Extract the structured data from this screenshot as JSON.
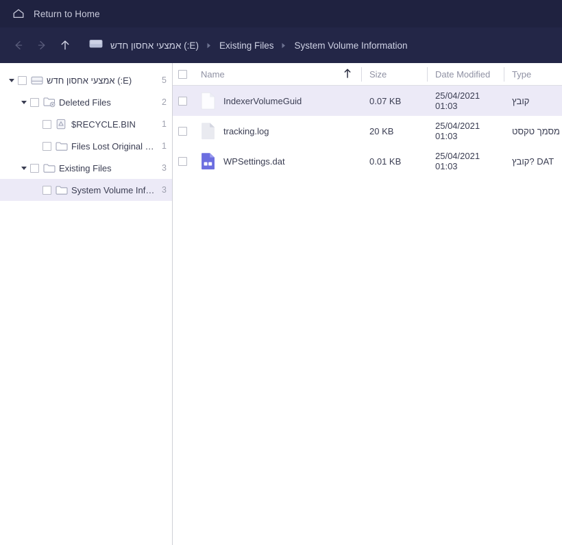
{
  "topbar": {
    "home_label": "Return to Home",
    "home_icon": "home-icon"
  },
  "navbar": {
    "back_icon": "arrow-left-icon",
    "forward_icon": "arrow-right-icon",
    "up_icon": "arrow-up-icon",
    "drive_icon": "drive-icon",
    "breadcrumbs": [
      {
        "label": "אמצעי אחסון חדש (:E)"
      },
      {
        "label": "Existing Files"
      },
      {
        "label": "System Volume Information"
      }
    ]
  },
  "sidebar": {
    "items": [
      {
        "label": "אמצעי אחסון חדש (:E)",
        "count": "5",
        "depth": 0,
        "icon": "drive-icon",
        "expanded": true,
        "has_twisty": true,
        "selected": false
      },
      {
        "label": "Deleted Files",
        "count": "2",
        "depth": 1,
        "icon": "folder-deleted-icon",
        "expanded": true,
        "has_twisty": true,
        "selected": false
      },
      {
        "label": "$RECYCLE.BIN",
        "count": "1",
        "depth": 2,
        "icon": "recycle-bin-icon",
        "expanded": false,
        "has_twisty": false,
        "selected": false
      },
      {
        "label": "Files Lost Original Direct...",
        "count": "1",
        "depth": 2,
        "icon": "folder-icon",
        "expanded": false,
        "has_twisty": false,
        "selected": false
      },
      {
        "label": "Existing Files",
        "count": "3",
        "depth": 1,
        "icon": "folder-icon",
        "expanded": true,
        "has_twisty": true,
        "selected": false
      },
      {
        "label": "System Volume Informati...",
        "count": "3",
        "depth": 2,
        "icon": "folder-icon",
        "expanded": false,
        "has_twisty": false,
        "selected": true
      }
    ]
  },
  "filelist": {
    "columns": {
      "name": "Name",
      "size": "Size",
      "date": "Date Modified",
      "type": "Type"
    },
    "sort": {
      "column": "name",
      "direction": "asc",
      "icon": "arrow-up-icon"
    },
    "rows": [
      {
        "name": "IndexerVolumeGuid",
        "size": "0.07 KB",
        "date": "25/04/2021 01:03",
        "type": "קובץ",
        "icon": "file-blank-icon",
        "selected": true
      },
      {
        "name": "tracking.log",
        "size": "20 KB",
        "date": "25/04/2021 01:03",
        "type": "מסמך טקסט",
        "icon": "file-text-icon",
        "selected": false
      },
      {
        "name": "WPSettings.dat",
        "size": "0.01 KB",
        "date": "25/04/2021 01:03",
        "type": "קובץ? DAT",
        "icon": "file-dat-icon",
        "selected": false
      }
    ]
  },
  "colors": {
    "topbar_bg": "#1f2240",
    "navbar_bg": "#232647",
    "selection": "#eceaf7",
    "accent_icon": "#6c6ee0",
    "text": "#3a3d52",
    "muted": "#8f91a3"
  }
}
